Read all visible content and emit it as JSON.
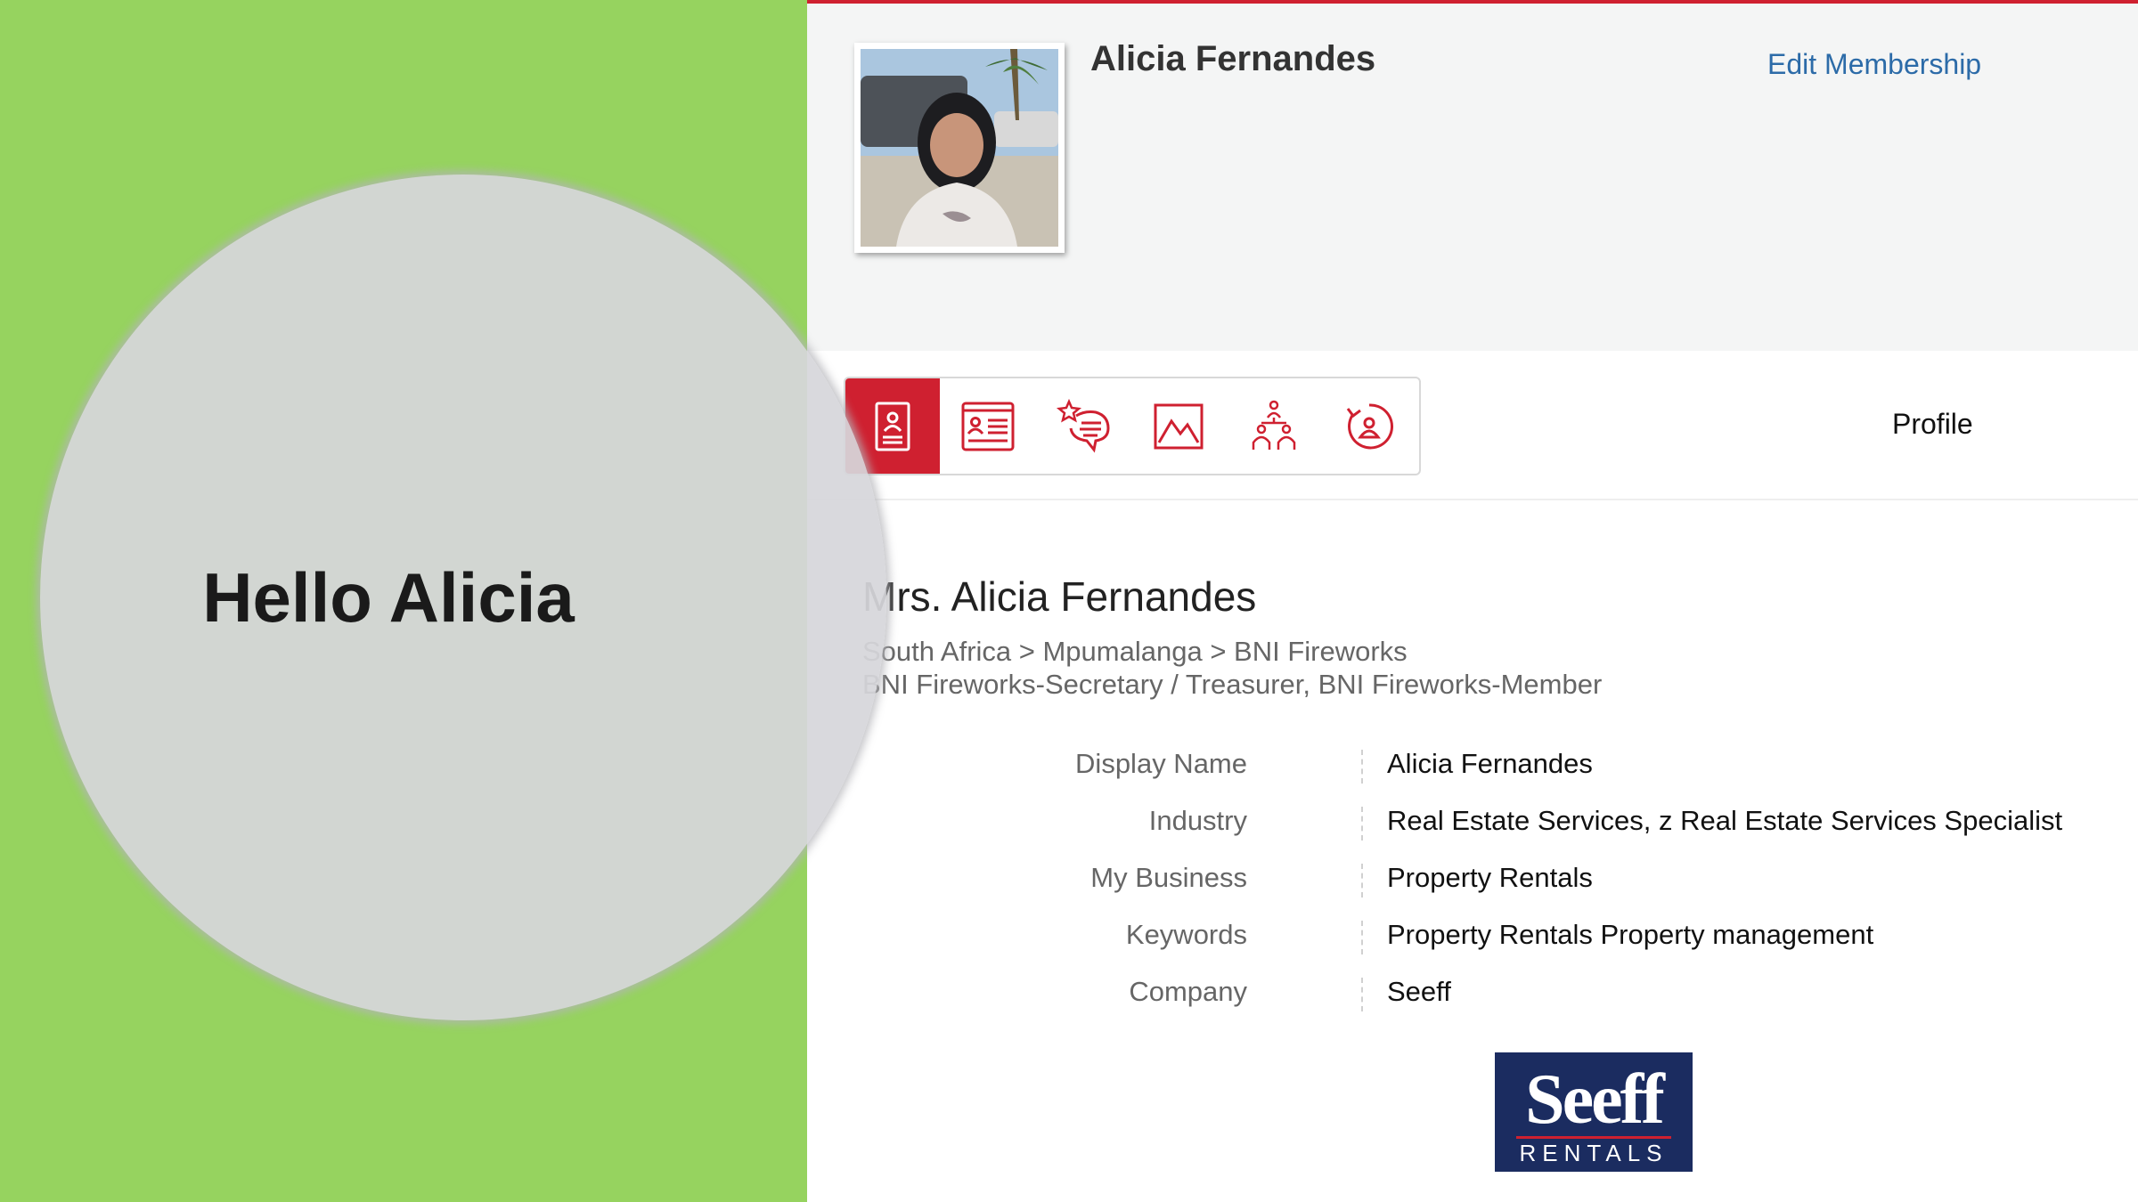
{
  "greeting": "Hello Alicia",
  "header": {
    "name": "Alicia Fernandes",
    "edit_link": "Edit Membership"
  },
  "tabs": [
    {
      "icon": "contact-card-icon",
      "active": true
    },
    {
      "icon": "id-card-icon",
      "active": false
    },
    {
      "icon": "testimonial-star-icon",
      "active": false
    },
    {
      "icon": "gallery-icon",
      "active": false
    },
    {
      "icon": "network-people-icon",
      "active": false
    },
    {
      "icon": "member-history-icon",
      "active": false
    }
  ],
  "section_title": "Profile",
  "profile": {
    "full_name": "Mrs. Alicia Fernandes",
    "breadcrumb": "South Africa > Mpumalanga > BNI Fireworks",
    "roles": "BNI Fireworks-Secretary / Treasurer, BNI Fireworks-Member"
  },
  "details": [
    {
      "label": "Display Name",
      "value": "Alicia Fernandes"
    },
    {
      "label": "Industry",
      "value": "Real Estate Services, z Real Estate Services Specialist"
    },
    {
      "label": "My Business",
      "value": "Property Rentals"
    },
    {
      "label": "Keywords",
      "value": "Property Rentals Property management"
    },
    {
      "label": "Company",
      "value": "Seeff"
    }
  ],
  "logo": {
    "word": "Seeff",
    "sub": "RENTALS"
  },
  "colors": {
    "accent": "#cf2030",
    "link": "#2c6ba8",
    "left_panel": "#96d35f",
    "logo_bg": "#1b2c60"
  }
}
